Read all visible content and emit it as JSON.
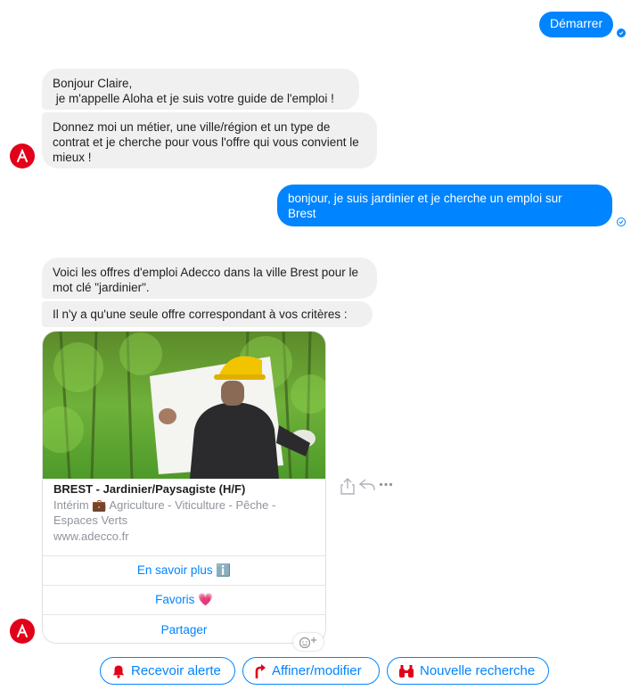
{
  "messages": {
    "out_start": "Démarrer",
    "in_greeting_line1": "Bonjour Claire,",
    "in_greeting_line2": " je m'appelle Aloha et je suis votre guide de l'emploi !",
    "in_prompt": "Donnez moi un métier, une ville/région et un type de contrat et je cherche pour vous l'offre qui vous convient le mieux !",
    "out_user_line1": "bonjour, je suis jardinier et je cherche un emploi sur",
    "out_user_line2": "Brest",
    "in_results": "Voici les offres d'emploi Adecco dans la ville Brest pour le mot clé \"jardinier\".",
    "in_single": "Il n'y a qu'une seule offre correspondant à vos critères :"
  },
  "card": {
    "title": "BREST - Jardinier/Paysagiste (H/F)",
    "subtitle": "Intérim 💼 Agriculture - Viticulture - Pêche - Espaces Verts",
    "url": "www.adecco.fr",
    "buttons": {
      "learn_more": "En savoir plus ℹ️",
      "favorites": "Favoris 💗",
      "share": "Partager"
    }
  },
  "quick_replies": {
    "alert": "Recevoir alerte",
    "refine": "Affiner/modifier",
    "new_search": "Nouvelle recherche"
  },
  "icons": {
    "avatar": "adecco-logo-icon",
    "share": "share-icon",
    "reply": "reply-icon",
    "more": "more-icon",
    "reaction": "add-reaction-icon"
  },
  "colors": {
    "accent": "#0084ff",
    "brand": "#e2001a",
    "bubble_in": "#f1f0f0"
  }
}
